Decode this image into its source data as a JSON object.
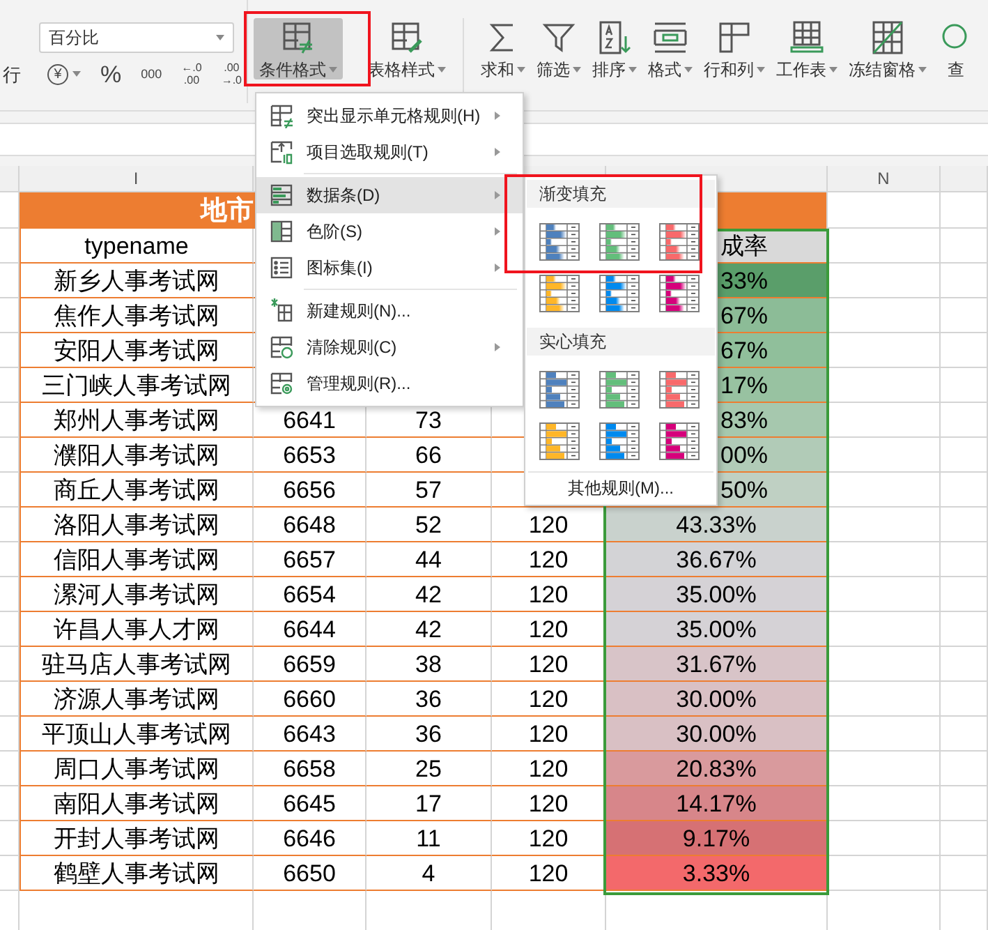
{
  "ribbon": {
    "wrap_label": "行",
    "number_format": {
      "value": "百分比"
    },
    "number_buttons": [
      {
        "kind": "currency",
        "label": "¥"
      },
      {
        "kind": "percent",
        "label": "%"
      },
      {
        "kind": "thousands",
        "label": "000"
      },
      {
        "kind": "stacked",
        "top": "←.0",
        "bottom": ".00"
      },
      {
        "kind": "stacked",
        "top": ".00",
        "bottom": "→.0"
      }
    ],
    "buttons": [
      {
        "label": "条件格式",
        "caret": true,
        "selected": true,
        "highlighted": true
      },
      {
        "label": "表格样式",
        "caret": true,
        "selected": false,
        "highlighted": false
      },
      {
        "label": "求和",
        "caret": true,
        "selected": false,
        "highlighted": false
      },
      {
        "label": "筛选",
        "caret": true,
        "selected": false,
        "highlighted": false
      },
      {
        "label": "排序",
        "caret": true,
        "selected": false,
        "highlighted": false
      },
      {
        "label": "格式",
        "caret": true,
        "selected": false,
        "highlighted": false
      },
      {
        "label": "行和列",
        "caret": true,
        "selected": false,
        "highlighted": false
      },
      {
        "label": "工作表",
        "caret": true,
        "selected": false,
        "highlighted": false
      },
      {
        "label": "冻结窗格",
        "caret": true,
        "selected": false,
        "highlighted": false
      },
      {
        "label": "查",
        "caret": false,
        "selected": false,
        "highlighted": false
      }
    ]
  },
  "sheet": {
    "columns": [
      {},
      {
        "letter": "I"
      },
      {},
      {},
      {},
      {},
      {
        "letter": "N"
      },
      {}
    ],
    "title": "地市",
    "header": {
      "typename": "typename",
      "rate": "成率"
    },
    "rows": [
      {
        "name": "新乡人事考试网",
        "rate": {
          "text": "33%",
          "cut": true,
          "color": "#5a9e6a"
        }
      },
      {
        "name": "焦作人事考试网",
        "rate": {
          "text": "67%",
          "cut": true,
          "color": "#8cbc97"
        }
      },
      {
        "name": "安阳人事考试网",
        "rate": {
          "text": "67%",
          "cut": true,
          "color": "#90bf9b"
        }
      },
      {
        "name": "三门峡人事考试网",
        "rate": {
          "text": "17%",
          "cut": true,
          "color": "#98c2a1"
        }
      },
      {
        "name": "郑州人事考试网",
        "id": "6641",
        "count": "73",
        "rate": {
          "text": "83%",
          "cut": true,
          "color": "#a6c8ae"
        }
      },
      {
        "name": "濮阳人事考试网",
        "id": "6653",
        "count": "66",
        "rate": {
          "text": "00%",
          "cut": true,
          "color": "#b1cbb7"
        }
      },
      {
        "name": "商丘人事考试网",
        "id": "6656",
        "count": "57",
        "rate": {
          "text": "50%",
          "cut": true,
          "color": "#bfd0c3"
        }
      },
      {
        "name": "洛阳人事考试网",
        "id": "6648",
        "count": "52",
        "total": "120",
        "rate": {
          "text": "43.33%",
          "cut": false,
          "color": "#c9d2cd"
        }
      },
      {
        "name": "信阳人事考试网",
        "id": "6657",
        "count": "44",
        "total": "120",
        "rate": {
          "text": "36.67%",
          "cut": false,
          "color": "#d3d3d6"
        }
      },
      {
        "name": "漯河人事考试网",
        "id": "6654",
        "count": "42",
        "total": "120",
        "rate": {
          "text": "35.00%",
          "cut": false,
          "color": "#d5d2d6"
        }
      },
      {
        "name": "许昌人事人才网",
        "id": "6644",
        "count": "42",
        "total": "120",
        "rate": {
          "text": "35.00%",
          "cut": false,
          "color": "#d5d2d6"
        }
      },
      {
        "name": "驻马店人事考试网",
        "id": "6659",
        "count": "38",
        "total": "120",
        "rate": {
          "text": "31.67%",
          "cut": false,
          "color": "#d8c4c8"
        }
      },
      {
        "name": "济源人事考试网",
        "id": "6660",
        "count": "36",
        "total": "120",
        "rate": {
          "text": "30.00%",
          "cut": false,
          "color": "#d9c0c4"
        }
      },
      {
        "name": "平顶山人事考试网",
        "id": "6643",
        "count": "36",
        "total": "120",
        "rate": {
          "text": "30.00%",
          "cut": false,
          "color": "#d9c0c4"
        }
      },
      {
        "name": "周口人事考试网",
        "id": "6658",
        "count": "25",
        "total": "120",
        "rate": {
          "text": "20.83%",
          "cut": false,
          "color": "#d99a9d"
        }
      },
      {
        "name": "南阳人事考试网",
        "id": "6645",
        "count": "17",
        "total": "120",
        "rate": {
          "text": "14.17%",
          "cut": false,
          "color": "#d7868a"
        }
      },
      {
        "name": "开封人事考试网",
        "id": "6646",
        "count": "11",
        "total": "120",
        "rate": {
          "text": "9.17%",
          "cut": false,
          "color": "#d67174"
        }
      },
      {
        "name": "鹤壁人事考试网",
        "id": "6650",
        "count": "4",
        "total": "120",
        "rate": {
          "text": "3.33%",
          "cut": false,
          "color": "#f3696b"
        }
      }
    ]
  },
  "menu": {
    "items": [
      {
        "kind": "item",
        "label": "突出显示单元格规则(H)",
        "submenu": true,
        "selected": false
      },
      {
        "kind": "item",
        "label": "项目选取规则(T)",
        "submenu": true,
        "selected": false
      },
      {
        "kind": "separator"
      },
      {
        "kind": "item",
        "label": "数据条(D)",
        "submenu": true,
        "selected": true
      },
      {
        "kind": "item",
        "label": "色阶(S)",
        "submenu": true,
        "selected": false
      },
      {
        "kind": "item",
        "label": "图标集(I)",
        "submenu": true,
        "selected": false
      },
      {
        "kind": "separator"
      },
      {
        "kind": "item",
        "label": "新建规则(N)...",
        "submenu": false,
        "selected": false
      },
      {
        "kind": "item",
        "label": "清除规则(C)",
        "submenu": true,
        "selected": false
      },
      {
        "kind": "item",
        "label": "管理规则(R)...",
        "submenu": false,
        "selected": false
      }
    ]
  },
  "submenu": {
    "sections": [
      {
        "title": "渐变填充",
        "kind": "gradient",
        "highlighted": true,
        "swatches": [
          {
            "color": "#4f81bd"
          },
          {
            "color": "#63be7b"
          },
          {
            "color": "#f8696b"
          },
          {
            "color": "#ffb628"
          },
          {
            "color": "#008aef"
          },
          {
            "color": "#d6007b"
          }
        ]
      },
      {
        "title": "实心填充",
        "kind": "solid",
        "highlighted": false,
        "swatches": [
          {
            "color": "#4f81bd"
          },
          {
            "color": "#63be7b"
          },
          {
            "color": "#f8696b"
          },
          {
            "color": "#ffb628"
          },
          {
            "color": "#008aef"
          },
          {
            "color": "#d6007b"
          }
        ]
      }
    ],
    "footer": "其他规则(M)..."
  }
}
